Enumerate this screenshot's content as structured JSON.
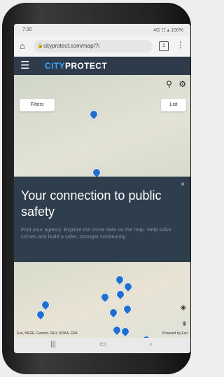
{
  "status": {
    "time": "7:30",
    "right": "4G ☷ ▴ 100%"
  },
  "browser": {
    "home_icon": "⌂",
    "lock_icon": "🔒",
    "url": "cityprotect.com/map/?i",
    "tab_count": "1",
    "more_icon": "⋮"
  },
  "app": {
    "menu_icon": "☰",
    "brand_city": "CITY",
    "brand_protect": "PROTECT",
    "search_icon": "⚲",
    "gear_icon": "⚙"
  },
  "map": {
    "filters_label": "Filters",
    "list_label": "List",
    "attribution": "Esri, HERE, Garmin, FAO, NOAA, EPA",
    "powered_by": "Powered by Esri",
    "locate_icon": "◈",
    "layers_icon": "⩩"
  },
  "banner": {
    "close_icon": "×",
    "title": "Your connection to public safety",
    "body": "Find your agency. Explore the crime data on the map. Help solve crimes and build a safer, stronger community."
  },
  "nav": {
    "recent_icon": "|||",
    "home_icon": "▭",
    "back_icon": "‹"
  },
  "colors": {
    "appbar": "#2d3b4a",
    "accent": "#3ba7ff",
    "pin": "#1e6fd0"
  }
}
